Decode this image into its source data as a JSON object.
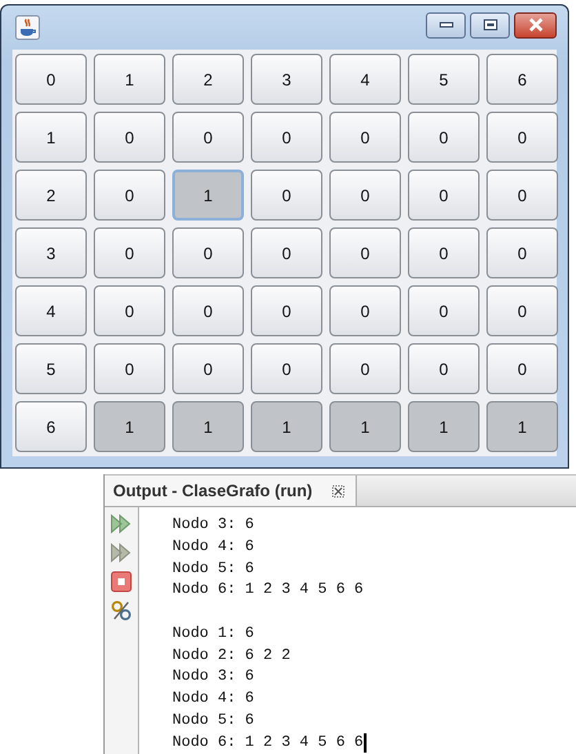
{
  "window": {
    "grid": [
      [
        {
          "label": "0",
          "pressed": false,
          "focused": false
        },
        {
          "label": "1",
          "pressed": false,
          "focused": false
        },
        {
          "label": "2",
          "pressed": false,
          "focused": false
        },
        {
          "label": "3",
          "pressed": false,
          "focused": false
        },
        {
          "label": "4",
          "pressed": false,
          "focused": false
        },
        {
          "label": "5",
          "pressed": false,
          "focused": false
        },
        {
          "label": "6",
          "pressed": false,
          "focused": false
        }
      ],
      [
        {
          "label": "1",
          "pressed": false,
          "focused": false
        },
        {
          "label": "0",
          "pressed": false,
          "focused": false
        },
        {
          "label": "0",
          "pressed": false,
          "focused": false
        },
        {
          "label": "0",
          "pressed": false,
          "focused": false
        },
        {
          "label": "0",
          "pressed": false,
          "focused": false
        },
        {
          "label": "0",
          "pressed": false,
          "focused": false
        },
        {
          "label": "0",
          "pressed": false,
          "focused": false
        }
      ],
      [
        {
          "label": "2",
          "pressed": false,
          "focused": false
        },
        {
          "label": "0",
          "pressed": false,
          "focused": false
        },
        {
          "label": "1",
          "pressed": true,
          "focused": true
        },
        {
          "label": "0",
          "pressed": false,
          "focused": false
        },
        {
          "label": "0",
          "pressed": false,
          "focused": false
        },
        {
          "label": "0",
          "pressed": false,
          "focused": false
        },
        {
          "label": "0",
          "pressed": false,
          "focused": false
        }
      ],
      [
        {
          "label": "3",
          "pressed": false,
          "focused": false
        },
        {
          "label": "0",
          "pressed": false,
          "focused": false
        },
        {
          "label": "0",
          "pressed": false,
          "focused": false
        },
        {
          "label": "0",
          "pressed": false,
          "focused": false
        },
        {
          "label": "0",
          "pressed": false,
          "focused": false
        },
        {
          "label": "0",
          "pressed": false,
          "focused": false
        },
        {
          "label": "0",
          "pressed": false,
          "focused": false
        }
      ],
      [
        {
          "label": "4",
          "pressed": false,
          "focused": false
        },
        {
          "label": "0",
          "pressed": false,
          "focused": false
        },
        {
          "label": "0",
          "pressed": false,
          "focused": false
        },
        {
          "label": "0",
          "pressed": false,
          "focused": false
        },
        {
          "label": "0",
          "pressed": false,
          "focused": false
        },
        {
          "label": "0",
          "pressed": false,
          "focused": false
        },
        {
          "label": "0",
          "pressed": false,
          "focused": false
        }
      ],
      [
        {
          "label": "5",
          "pressed": false,
          "focused": false
        },
        {
          "label": "0",
          "pressed": false,
          "focused": false
        },
        {
          "label": "0",
          "pressed": false,
          "focused": false
        },
        {
          "label": "0",
          "pressed": false,
          "focused": false
        },
        {
          "label": "0",
          "pressed": false,
          "focused": false
        },
        {
          "label": "0",
          "pressed": false,
          "focused": false
        },
        {
          "label": "0",
          "pressed": false,
          "focused": false
        }
      ],
      [
        {
          "label": "6",
          "pressed": false,
          "focused": false
        },
        {
          "label": "1",
          "pressed": true,
          "focused": false
        },
        {
          "label": "1",
          "pressed": true,
          "focused": false
        },
        {
          "label": "1",
          "pressed": true,
          "focused": false
        },
        {
          "label": "1",
          "pressed": true,
          "focused": false
        },
        {
          "label": "1",
          "pressed": true,
          "focused": false
        },
        {
          "label": "1",
          "pressed": true,
          "focused": false
        }
      ]
    ]
  },
  "output": {
    "tab": {
      "label": "Output - ClaseGrafo (run)",
      "selected": true
    },
    "blocks": [
      [
        "Nodo 3: 6",
        "Nodo 4: 6",
        "Nodo 5: 6",
        "Nodo 6: 1 2 3 4 5 6 6"
      ],
      [
        "Nodo 1: 6",
        "Nodo 2: 6 2 2",
        "Nodo 3: 6",
        "Nodo 4: 6",
        "Nodo 5: 6",
        "Nodo 6: 1 2 3 4 5 6 6"
      ]
    ]
  }
}
